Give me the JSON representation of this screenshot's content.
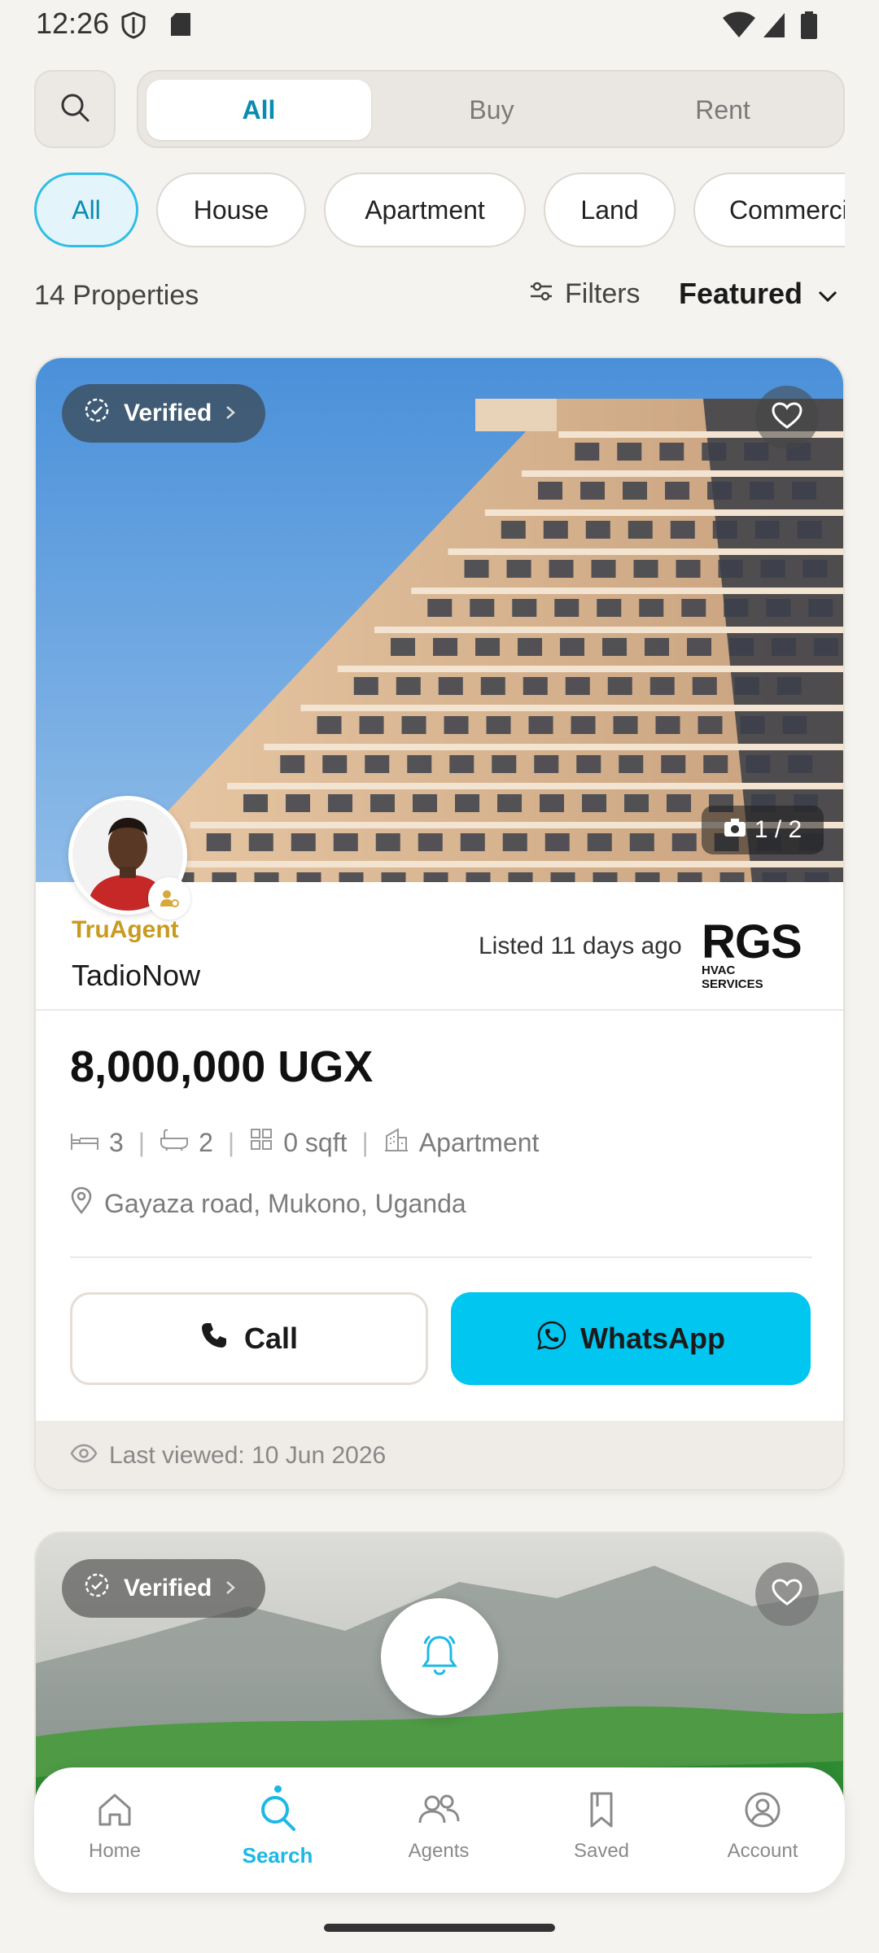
{
  "status_bar": {
    "time": "12:26"
  },
  "search": {
    "icon": "search-icon"
  },
  "segmented": {
    "items": [
      "All",
      "Buy",
      "Rent"
    ],
    "active": "All"
  },
  "chips": [
    "All",
    "House",
    "Apartment",
    "Land",
    "Commercial"
  ],
  "results": {
    "count_label": "14 Properties",
    "filters_label": "Filters",
    "sort_label": "Featured"
  },
  "listing": {
    "verified_label": "Verified",
    "photo_counter": "1 / 2",
    "agent_tag": "TruAgent",
    "agent_name": "TadioNow",
    "listed": "Listed 11 days ago",
    "brand": {
      "main": "RGS",
      "sub": "HVAC SERVICES"
    },
    "price": "8,000,000 UGX",
    "beds": "3",
    "baths": "2",
    "area": "0 sqft",
    "type": "Apartment",
    "location": "Gayaza road, Mukono, Uganda",
    "call_label": "Call",
    "whatsapp_label": "WhatsApp",
    "last_viewed": "Last viewed: 10 Jun 2026"
  },
  "listing_2": {
    "verified_label": "Verified"
  },
  "bottom_nav": [
    {
      "label": "Home",
      "icon": "home-icon"
    },
    {
      "label": "Search",
      "icon": "search-icon",
      "active": true
    },
    {
      "label": "Agents",
      "icon": "agents-icon"
    },
    {
      "label": "Saved",
      "icon": "bookmark-icon"
    },
    {
      "label": "Account",
      "icon": "account-icon"
    }
  ],
  "colors": {
    "accent": "#1CB8E6",
    "whatsapp_button": "#00C6F0",
    "agent_tag": "#C99A1E",
    "background": "#F5F3EF"
  }
}
